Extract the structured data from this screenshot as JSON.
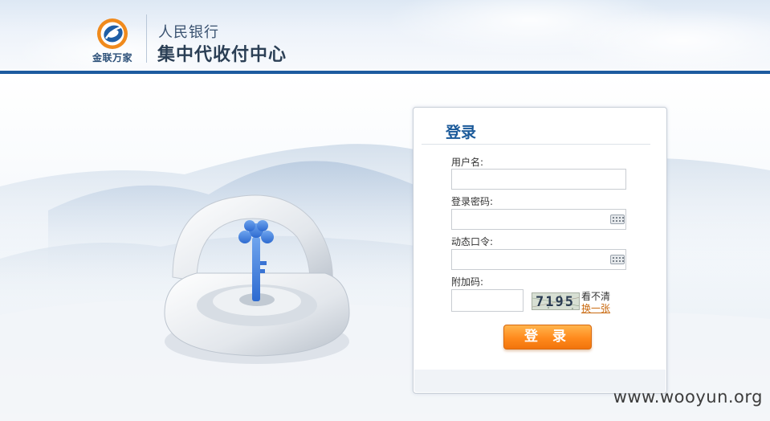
{
  "header": {
    "logo_text": "金联万家",
    "bank_name": "人民银行",
    "center_name": "集中代收付中心",
    "colors": {
      "rule": "#1c5b9f",
      "title": "#1b5a9a"
    }
  },
  "login": {
    "title": "登录",
    "username_label": "用户名:",
    "password_label": "登录密码:",
    "otp_label": "动态口令:",
    "captcha_label": "附加码:",
    "captcha_code": "7195",
    "unclear_text": "看不清",
    "refresh_link": "换一张",
    "submit_label": "登 录",
    "keyboard_icon": "keyboard-icon"
  },
  "watermark": "www.wooyun.org"
}
